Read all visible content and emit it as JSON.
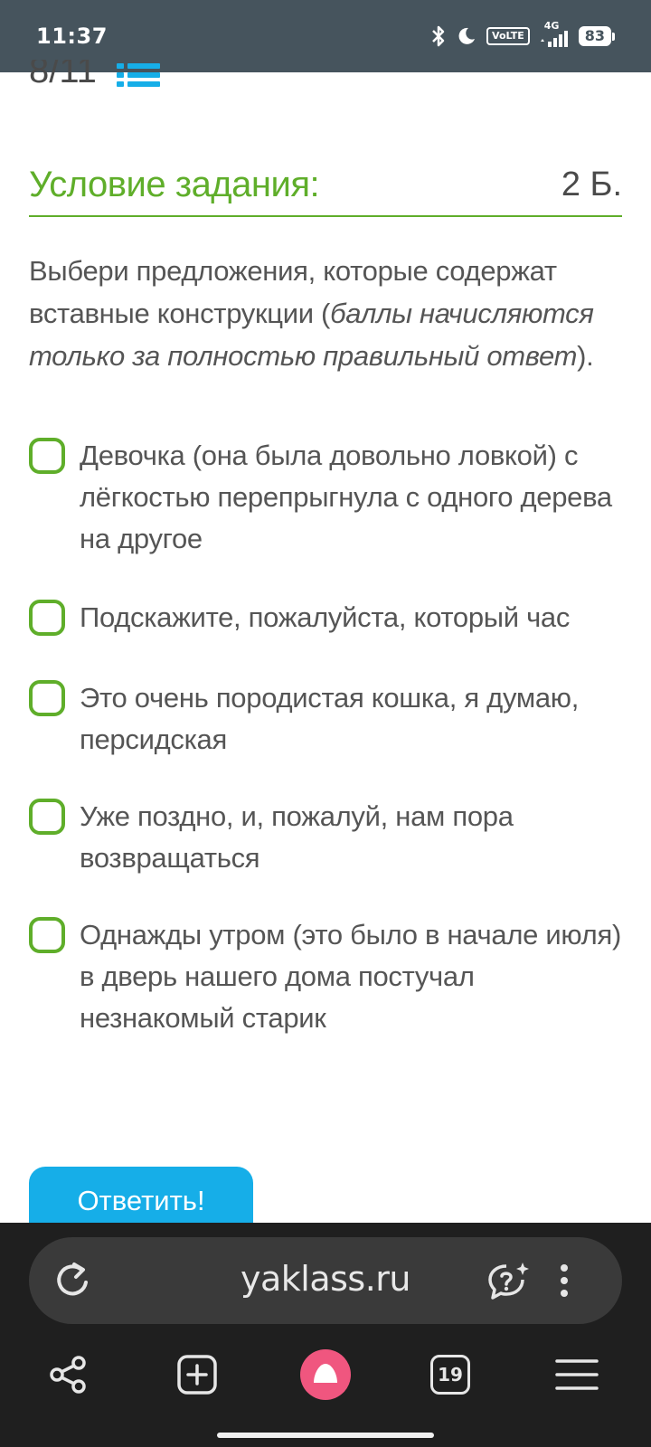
{
  "status_bar": {
    "time": "11:37",
    "volte": "VoLTE",
    "network": "4G",
    "battery": "83"
  },
  "progress": {
    "text": "8/11"
  },
  "condition": {
    "title": "Условие задания:",
    "points": "2 Б."
  },
  "task": {
    "prefix": "Выбери предложения, которые содержат вставные конструкции (",
    "emphasis": "баллы начисляются только за полностью правильный ответ",
    "suffix": ")."
  },
  "options": [
    {
      "label": "Девочка (она была довольно ловкой) с лёгкостью перепрыгнула с одного дерева на другое",
      "checked": false
    },
    {
      "label": "Подскажите, пожалуйста, который час",
      "checked": false
    },
    {
      "label": "Это очень породистая кошка, я думаю, персидская",
      "checked": false
    },
    {
      "label": "Уже поздно, и, пожалуй, нам пора возвращаться",
      "checked": false
    },
    {
      "label": "Однажды утром (это было в начале июля) в дверь нашего дома постучал незнакомый старик",
      "checked": false
    }
  ],
  "answer_button": {
    "label": "Ответить!"
  },
  "browser": {
    "url": "yaklass.ru",
    "tabs_count": "19"
  },
  "colors": {
    "accent_green": "#5fae2a",
    "button_blue": "#16aee8",
    "status_bar_bg": "#46545d",
    "alice_pink": "#f0567f"
  },
  "icons": {
    "bluetooth": "bluetooth-icon",
    "moon": "moon-icon",
    "signal": "signal-icon",
    "list": "list-icon",
    "reload": "reload-icon",
    "assistant": "chat-sparkle-icon",
    "more": "more-vertical-icon",
    "share": "share-icon",
    "new_tab": "new-tab-icon",
    "alice": "alice-icon",
    "menu": "menu-icon"
  }
}
